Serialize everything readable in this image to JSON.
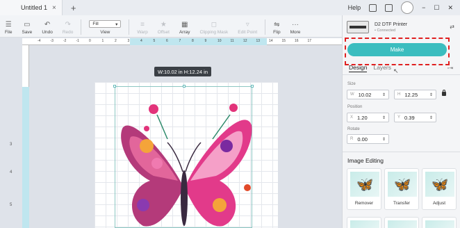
{
  "window": {
    "tab_title": "Untitled 1",
    "tab_close": "×",
    "new_tab": "+",
    "help": "Help"
  },
  "toolbar": {
    "file": "File",
    "save": "Save",
    "undo": "Undo",
    "redo": "Redo",
    "fill_value": "Fill",
    "view": "View",
    "warp": "Warp",
    "offset": "Offset",
    "array": "Array",
    "clipping_mask": "Clipping Mask",
    "edit_point": "Edit Point",
    "flip": "Flip",
    "more": "More"
  },
  "ruler": {
    "top_ticks": [
      "-4",
      "-3",
      "-2",
      "-1",
      "0",
      "1",
      "2",
      "3",
      "4",
      "5",
      "6",
      "7",
      "8",
      "9",
      "10",
      "11",
      "12",
      "13",
      "14",
      "15",
      "16",
      "17"
    ],
    "left_ticks": [
      "3",
      "4",
      "5",
      "6"
    ]
  },
  "canvas": {
    "dimension_tooltip": "W:10.02 in  H:12.24 in"
  },
  "panel": {
    "printer_name": "D2 DTF Printer",
    "printer_sub": "• Connected",
    "make_button": "Make",
    "tab_design": "Design",
    "tab_layers": "Layers",
    "size_label": "Size",
    "w_label": "W",
    "w_value": "10.02",
    "h_label": "H",
    "h_value": "12.25",
    "position_label": "Position",
    "x_label": "X",
    "x_value": "1.20",
    "y_label": "Y",
    "y_value": "0.39",
    "rotate_label": "Rotate",
    "r_label": "R",
    "r_value": "0.00",
    "image_editing_title": "Image Editing",
    "ie_remover": "Remover",
    "ie_transfer": "Transfer",
    "ie_adjust": "Adjust"
  },
  "colors": {
    "accent": "#3bbdbf",
    "highlight_dashed": "#e02020"
  }
}
